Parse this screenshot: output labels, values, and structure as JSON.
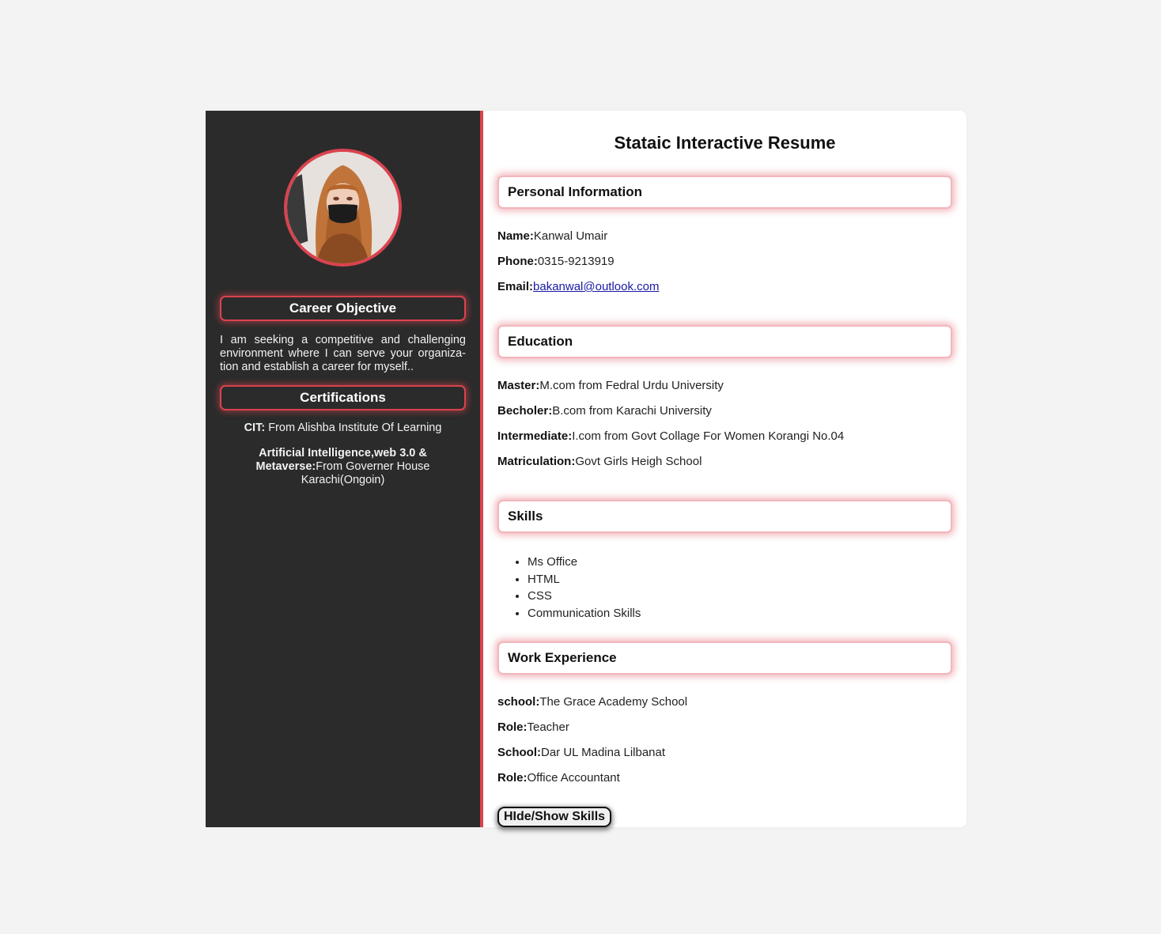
{
  "colors": {
    "accent": "#d9434f",
    "sidebar_bg": "#2b2b2b",
    "page_bg": "#f3f3f3",
    "link": "#1a1aa6"
  },
  "sidebar": {
    "avatar": "profile-photo",
    "objective_heading": "Career Objective",
    "objective_text": "I am seeking a competitive and challenging environment where I can serve your organiza- tion and establish a career for myself..",
    "certifications_heading": "Certifications",
    "certifications": [
      {
        "label": "CIT:",
        "value": " From Alishba Institute Of Learning"
      },
      {
        "label": "Artificial Intelligence,web 3.0 & Metaverse:",
        "value": "From Governer House Karachi(Ongoin)"
      }
    ]
  },
  "main": {
    "title": "Stataic Interactive Resume",
    "personal": {
      "heading": "Personal Information",
      "name_label": "Name:",
      "name_value": "Kanwal Umair",
      "phone_label": "Phone:",
      "phone_value": "0315-9213919",
      "email_label": "Email:",
      "email_value": "bakanwal@outlook.com"
    },
    "education": {
      "heading": "Education",
      "items": [
        {
          "label": "Master:",
          "value": "M.com from Fedral Urdu University"
        },
        {
          "label": "Becholer:",
          "value": "B.com from Karachi University"
        },
        {
          "label": "Intermediate:",
          "value": "I.com from Govt Collage For Women Korangi No.04"
        },
        {
          "label": "Matriculation:",
          "value": "Govt Girls Heigh School"
        }
      ]
    },
    "skills": {
      "heading": "Skills",
      "items": [
        "Ms Office",
        "HTML",
        "CSS",
        "Communication Skills"
      ]
    },
    "work": {
      "heading": "Work Experience",
      "items": [
        {
          "label": "school:",
          "value": "The Grace Academy School"
        },
        {
          "label": "Role:",
          "value": "Teacher"
        },
        {
          "label": "School:",
          "value": "Dar UL Madina Lilbanat"
        },
        {
          "label": "Role:",
          "value": "Office Accountant"
        }
      ]
    },
    "toggle_button": "HIde/Show Skills"
  }
}
